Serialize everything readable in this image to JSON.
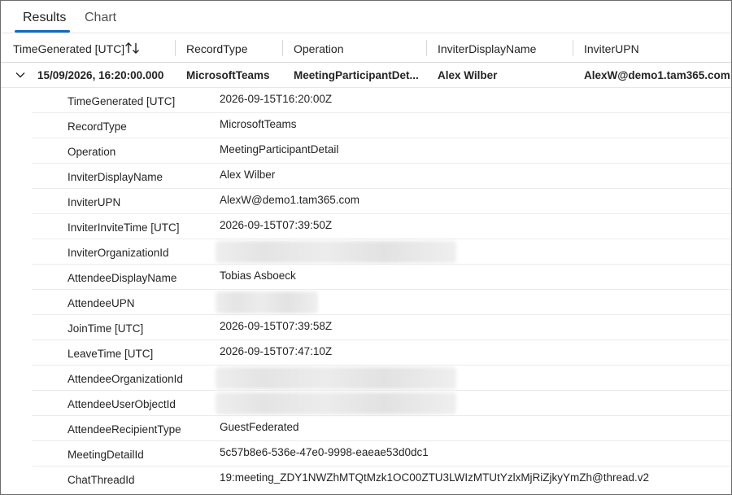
{
  "tabs": [
    {
      "label": "Results",
      "active": true
    },
    {
      "label": "Chart",
      "active": false
    }
  ],
  "columns": [
    "TimeGenerated [UTC]",
    "RecordType",
    "Operation",
    "InviterDisplayName",
    "InviterUPN"
  ],
  "main_row": {
    "time": "15/09/2026, 16:20:00.000",
    "record_type": "MicrosoftTeams",
    "operation": "MeetingParticipantDet...",
    "inviter_display_name": "Alex Wilber",
    "inviter_upn": "AlexW@demo1.tam365.com"
  },
  "details": [
    {
      "key": "TimeGenerated [UTC]",
      "value": "2026-09-15T16:20:00Z"
    },
    {
      "key": "RecordType",
      "value": "MicrosoftTeams"
    },
    {
      "key": "Operation",
      "value": "MeetingParticipantDetail"
    },
    {
      "key": "InviterDisplayName",
      "value": "Alex Wilber"
    },
    {
      "key": "InviterUPN",
      "value": "AlexW@demo1.tam365.com"
    },
    {
      "key": "InviterInviteTime [UTC]",
      "value": "2026-09-15T07:39:50Z"
    },
    {
      "key": "InviterOrganizationId",
      "value": ""
    },
    {
      "key": "AttendeeDisplayName",
      "value": "Tobias Asboeck"
    },
    {
      "key": "AttendeeUPN",
      "value": ""
    },
    {
      "key": "JoinTime [UTC]",
      "value": "2026-09-15T07:39:58Z"
    },
    {
      "key": "LeaveTime [UTC]",
      "value": "2026-09-15T07:47:10Z"
    },
    {
      "key": "AttendeeOrganizationId",
      "value": ""
    },
    {
      "key": "AttendeeUserObjectId",
      "value": ""
    },
    {
      "key": "AttendeeRecipientType",
      "value": "GuestFederated"
    },
    {
      "key": "MeetingDetailId",
      "value": "5c57b8e6-536e-47e0-9998-eaeae53d0dc1"
    },
    {
      "key": "ChatThreadId",
      "value": "19:meeting_ZDY1NWZhMTQtMzk1OC00ZTU3LWIzMTUtYzlxMjRiZjkyYmZh@thread.v2"
    }
  ],
  "colors": {
    "accent": "#0f6cbd",
    "text": "#242424",
    "border": "#6b6b6b"
  },
  "icons": {
    "sort": "sort-arrows-icon",
    "expand": "chevron-down-icon"
  }
}
